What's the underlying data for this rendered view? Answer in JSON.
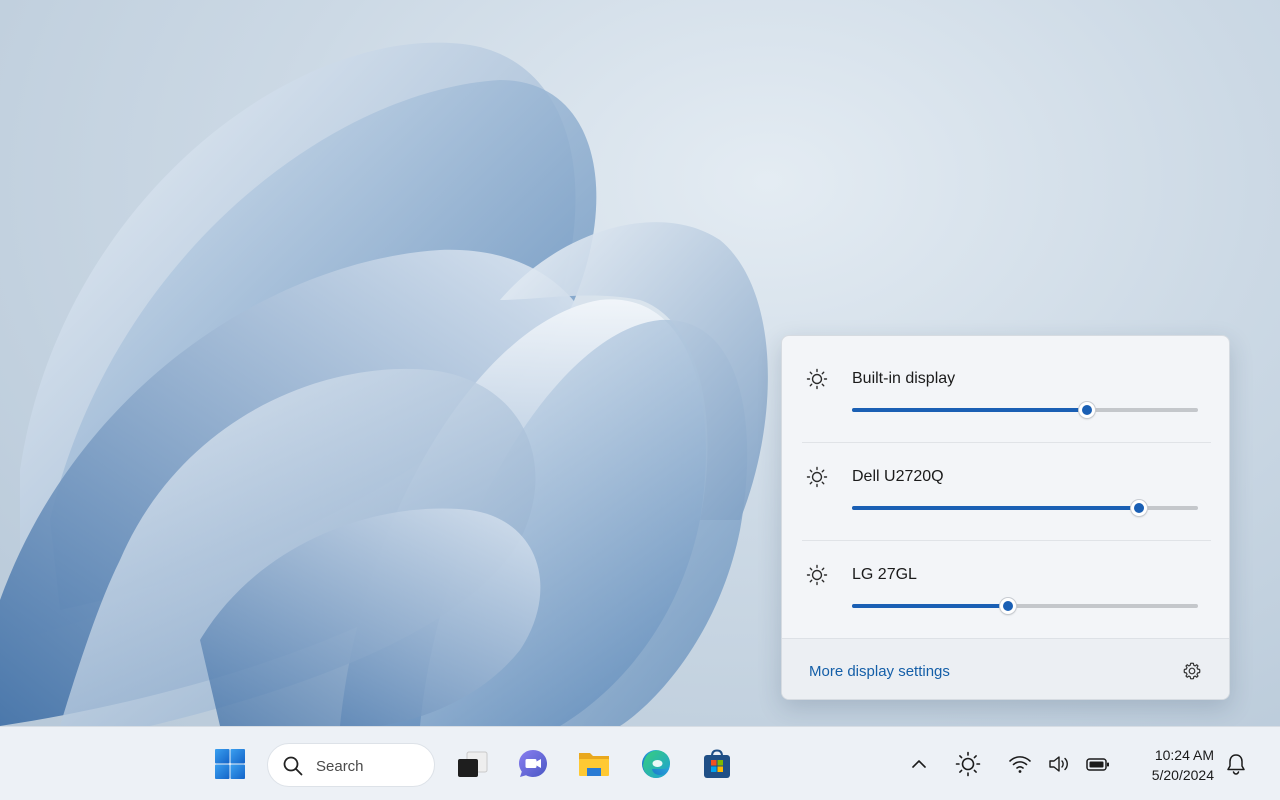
{
  "flyout": {
    "displays": [
      {
        "name": "Built-in display",
        "brightness": 68,
        "icon": "sun-icon"
      },
      {
        "name": "Dell U2720Q",
        "brightness": 83,
        "icon": "sun-icon"
      },
      {
        "name": "LG 27GL",
        "brightness": 45,
        "icon": "sun-icon"
      }
    ],
    "footer_link": "More display settings",
    "footer_icon": "gear-icon"
  },
  "taskbar": {
    "search_placeholder": "Search",
    "apps": [
      "windows-start-icon",
      "task-view-icon",
      "teams-chat-icon",
      "file-explorer-icon",
      "edge-icon",
      "microsoft-store-icon"
    ],
    "tray_icons": [
      "chevron-up-icon",
      "brightness-icon",
      "wifi-icon",
      "speaker-icon",
      "battery-icon",
      "bell-icon"
    ],
    "time": "10:24 AM",
    "date": "5/20/2024"
  },
  "colors": {
    "accent": "#1a5fb4",
    "link": "#155fa8",
    "taskbar_bg": "#edf1f6",
    "flyout_bg": "#f3f5f8"
  }
}
